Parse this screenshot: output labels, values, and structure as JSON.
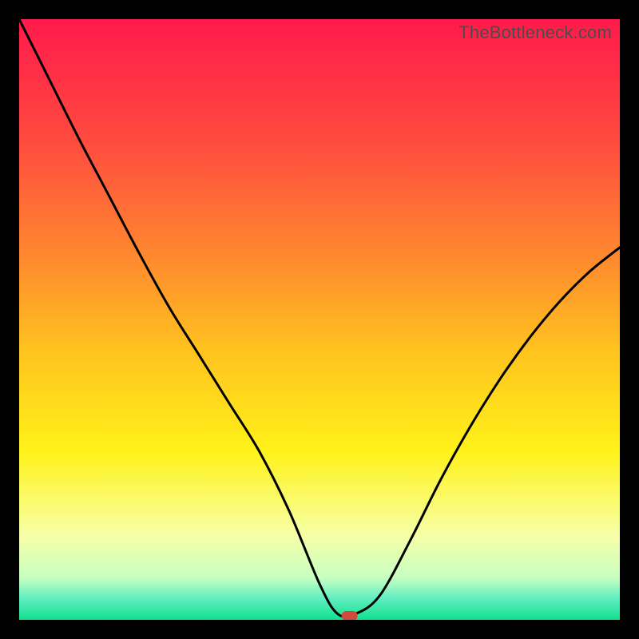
{
  "watermark": "TheBottleneck.com",
  "chart_data": {
    "type": "line",
    "title": "",
    "xlabel": "",
    "ylabel": "",
    "xlim": [
      0,
      100
    ],
    "ylim": [
      0,
      100
    ],
    "x": [
      0,
      5,
      10,
      15,
      20,
      25,
      30,
      35,
      40,
      45,
      50,
      53,
      56,
      60,
      65,
      70,
      75,
      80,
      85,
      90,
      95,
      100
    ],
    "values": [
      100,
      90,
      80,
      70.5,
      61,
      52,
      44,
      36,
      28,
      18,
      6,
      1,
      1,
      4,
      13,
      23,
      32,
      40,
      47,
      53,
      58,
      62
    ],
    "minimum_index_pct": 55,
    "minimum_marker_color": "#d24a3a",
    "gradient_stops": [
      {
        "pos": 0.0,
        "color": "#ff1a4b"
      },
      {
        "pos": 0.2,
        "color": "#ff4a3f"
      },
      {
        "pos": 0.4,
        "color": "#ff8a2e"
      },
      {
        "pos": 0.55,
        "color": "#ffc21f"
      },
      {
        "pos": 0.72,
        "color": "#fff219"
      },
      {
        "pos": 0.86,
        "color": "#f7ffa8"
      },
      {
        "pos": 0.93,
        "color": "#c7ffc1"
      },
      {
        "pos": 0.965,
        "color": "#5feec0"
      },
      {
        "pos": 1.0,
        "color": "#10e08f"
      }
    ]
  }
}
